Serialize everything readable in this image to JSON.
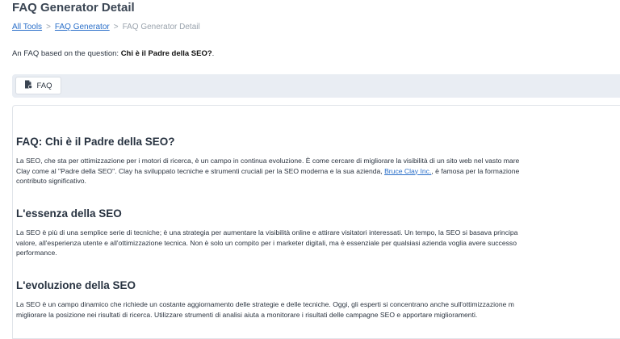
{
  "page": {
    "title": "FAQ Generator Detail"
  },
  "breadcrumb": {
    "items": [
      "All Tools",
      "FAQ Generator",
      "FAQ Generator Detail"
    ],
    "separator": ">"
  },
  "intro": {
    "prefix": "An FAQ based on the question:",
    "question": "Chi è il Padre della SEO?",
    "suffix": "."
  },
  "tabs": [
    {
      "label": "FAQ",
      "icon": "document-icon",
      "active": true
    }
  ],
  "article": {
    "heading": "FAQ: Chi è il Padre della SEO?",
    "p1_line1": "La SEO, che sta per ottimizzazione per i motori di ricerca, è un campo in continua evoluzione. È come cercare di migliorare la visibilità di un sito web nel vasto mare",
    "p1_line2_before": "Clay come al \"Padre della SEO\". Clay ha sviluppato tecniche e strumenti cruciali per la SEO moderna e la sua azienda,",
    "p1_link": "Bruce Clay Inc.",
    "p1_line2_after": ", è famosa per la formazione",
    "p1_line3": "contributo significativo.",
    "section1_heading": "L'essenza della SEO",
    "p2_line1": "La SEO è più di una semplice serie di tecniche; è una strategia per aumentare la visibilità online e attirare visitatori interessati. Un tempo, la SEO si basava principa",
    "p2_line2": "valore, all'esperienza utente e all'ottimizzazione tecnica. Non è solo un compito per i marketer digitali, ma è essenziale per qualsiasi azienda voglia avere successo",
    "p2_line3": "performance.",
    "section2_heading": "L'evoluzione della SEO",
    "p3_line1": "La SEO è un campo dinamico che richiede un costante aggiornamento delle strategie e delle tecniche. Oggi, gli esperti si concentrano anche sull'ottimizzazione m",
    "p3_line2": "migliorare la posizione nei risultati di ricerca. Utilizzare strumenti di analisi aiuta a monitorare i risultati delle campagne SEO e apportare miglioramenti."
  }
}
